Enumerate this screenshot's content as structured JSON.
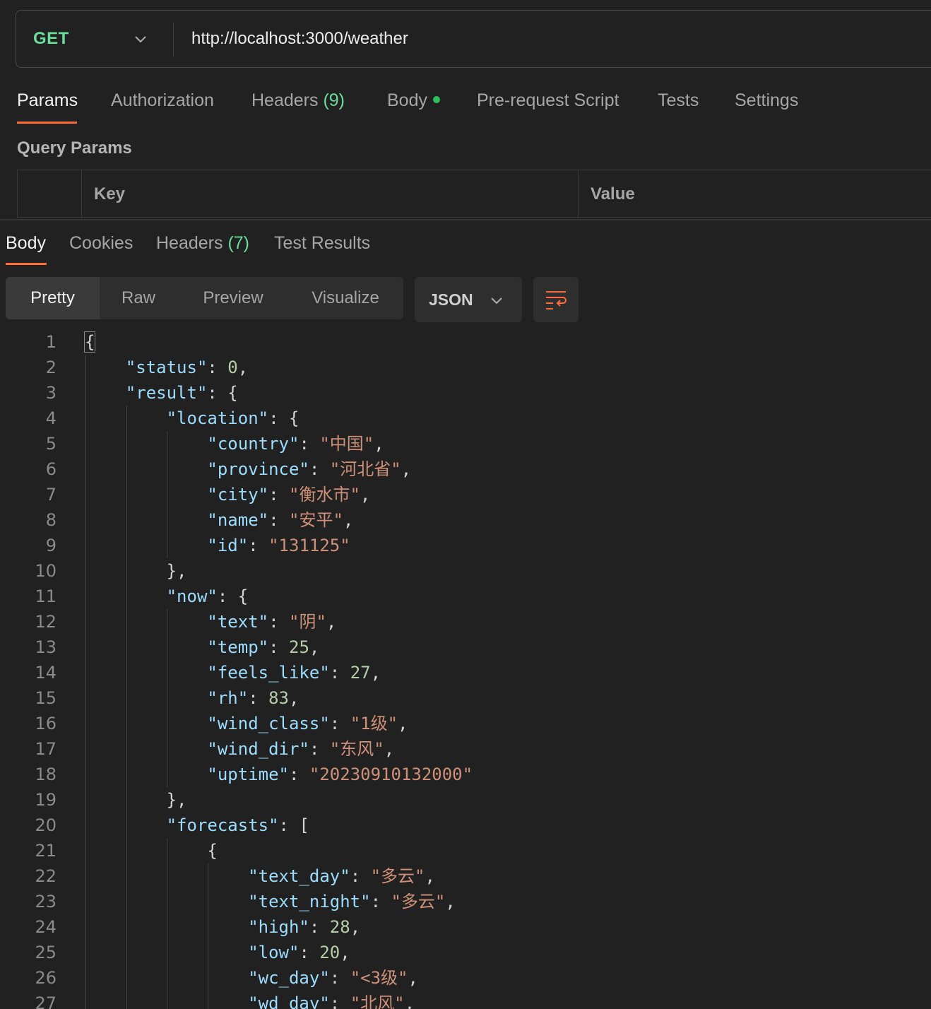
{
  "request": {
    "method": "GET",
    "url": "http://localhost:3000/weather"
  },
  "request_tabs": {
    "params": "Params",
    "authorization": "Authorization",
    "headers": "Headers",
    "headers_count": "(9)",
    "body": "Body",
    "pre_request": "Pre-request Script",
    "tests": "Tests",
    "settings": "Settings"
  },
  "query_params": {
    "title": "Query Params",
    "col_key": "Key",
    "col_value": "Value"
  },
  "response_tabs": {
    "body": "Body",
    "cookies": "Cookies",
    "headers": "Headers",
    "headers_count": "(7)",
    "test_results": "Test Results"
  },
  "view_modes": {
    "pretty": "Pretty",
    "raw": "Raw",
    "preview": "Preview",
    "visualize": "Visualize"
  },
  "format": "JSON",
  "colors": {
    "accent": "#ff6c37",
    "method_get": "#6bdd9a",
    "json_key": "#9cdcfe",
    "json_string": "#ce9178",
    "json_number": "#b5cea8"
  },
  "code_lines": [
    {
      "n": "1"
    },
    {
      "n": "2"
    },
    {
      "n": "3"
    },
    {
      "n": "4"
    },
    {
      "n": "5"
    },
    {
      "n": "6"
    },
    {
      "n": "7"
    },
    {
      "n": "8"
    },
    {
      "n": "9"
    },
    {
      "n": "10"
    },
    {
      "n": "11"
    },
    {
      "n": "12"
    },
    {
      "n": "13"
    },
    {
      "n": "14"
    },
    {
      "n": "15"
    },
    {
      "n": "16"
    },
    {
      "n": "17"
    },
    {
      "n": "18"
    },
    {
      "n": "19"
    },
    {
      "n": "20"
    },
    {
      "n": "21"
    },
    {
      "n": "22"
    },
    {
      "n": "23"
    },
    {
      "n": "24"
    },
    {
      "n": "25"
    },
    {
      "n": "26"
    },
    {
      "n": "27"
    }
  ],
  "json": {
    "status": {
      "key": "\"status\"",
      "val": "0"
    },
    "result": {
      "key": "\"result\""
    },
    "location": {
      "key": "\"location\""
    },
    "country": {
      "key": "\"country\"",
      "val": "\"中国\""
    },
    "province": {
      "key": "\"province\"",
      "val": "\"河北省\""
    },
    "city": {
      "key": "\"city\"",
      "val": "\"衡水市\""
    },
    "name": {
      "key": "\"name\"",
      "val": "\"安平\""
    },
    "id": {
      "key": "\"id\"",
      "val": "\"131125\""
    },
    "now": {
      "key": "\"now\""
    },
    "text": {
      "key": "\"text\"",
      "val": "\"阴\""
    },
    "temp": {
      "key": "\"temp\"",
      "val": "25"
    },
    "feels_like": {
      "key": "\"feels_like\"",
      "val": "27"
    },
    "rh": {
      "key": "\"rh\"",
      "val": "83"
    },
    "wind_class": {
      "key": "\"wind_class\"",
      "val": "\"1级\""
    },
    "wind_dir": {
      "key": "\"wind_dir\"",
      "val": "\"东风\""
    },
    "uptime": {
      "key": "\"uptime\"",
      "val": "\"20230910132000\""
    },
    "forecasts": {
      "key": "\"forecasts\""
    },
    "text_day": {
      "key": "\"text_day\"",
      "val": "\"多云\""
    },
    "text_night": {
      "key": "\"text_night\"",
      "val": "\"多云\""
    },
    "high": {
      "key": "\"high\"",
      "val": "28"
    },
    "low": {
      "key": "\"low\"",
      "val": "20"
    },
    "wc_day": {
      "key": "\"wc_day\"",
      "val": "\"<3级\""
    },
    "wd_day": {
      "key": "\"wd_day\"",
      "val": "\"北风\""
    }
  }
}
